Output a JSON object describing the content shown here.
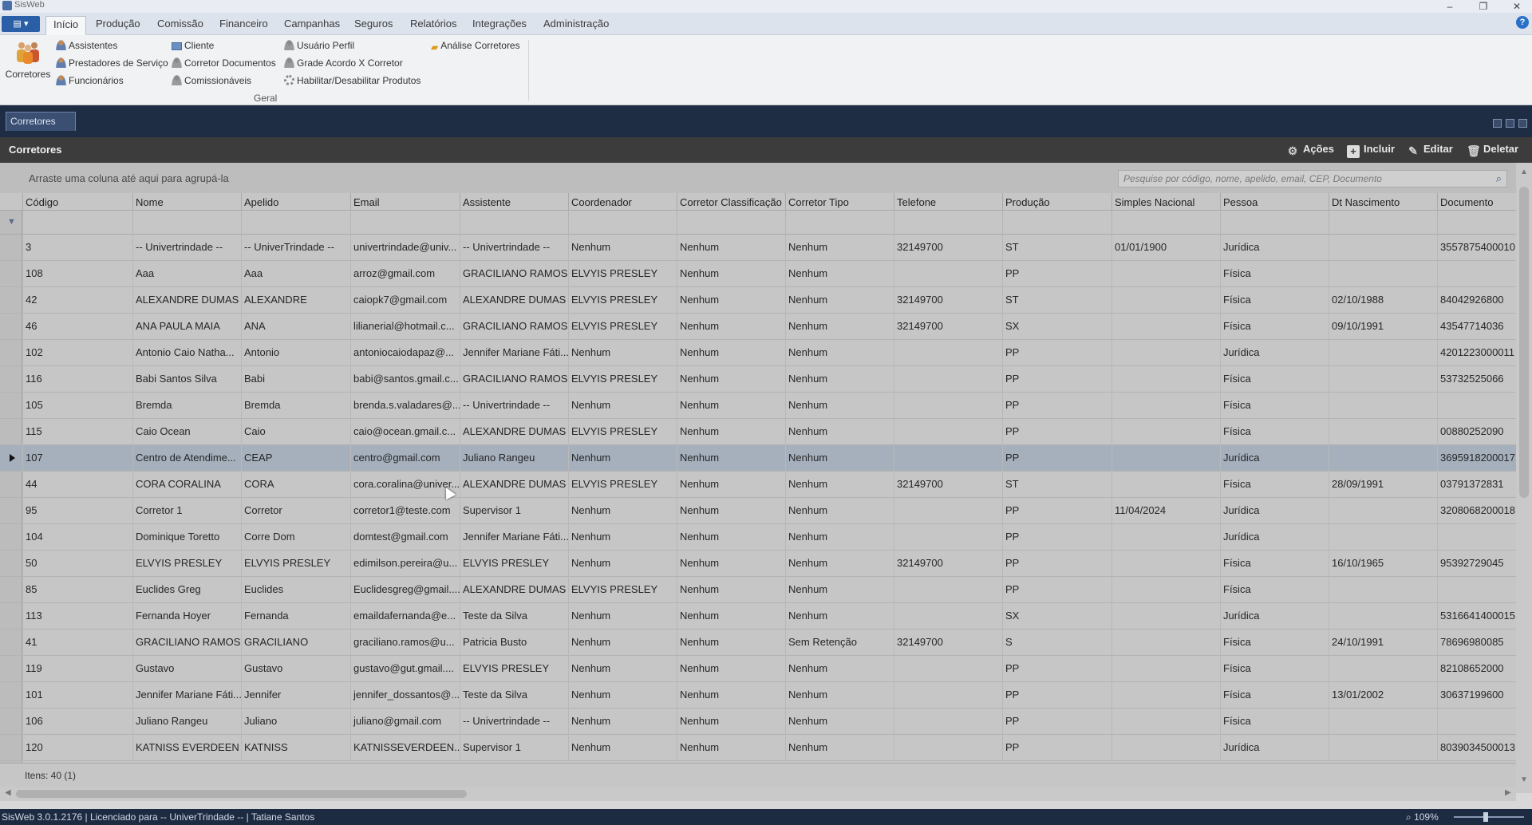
{
  "window": {
    "title": "SisWeb",
    "minimize": "–",
    "restore": "❐",
    "close": "✕"
  },
  "menu": {
    "app_button": "▤ ▾",
    "tabs": [
      "Início",
      "Produção",
      "Comissão",
      "Financeiro",
      "Campanhas",
      "Seguros",
      "Relatórios",
      "Integrações",
      "Administração"
    ],
    "help": "?"
  },
  "ribbon": {
    "big_button": "Corretores",
    "col1": [
      "Assistentes",
      "Prestadores de Serviço",
      "Funcionários"
    ],
    "col2": [
      "Cliente",
      "Corretor Documentos",
      "Comissionáveis"
    ],
    "col3": [
      "Usuário Perfil",
      "Grade Acordo X Corretor",
      "Habilitar/Desabilitar Produtos"
    ],
    "col4": [
      "Análise Corretores"
    ],
    "group_label": "Geral"
  },
  "doc_tab": "Corretores",
  "panel": {
    "title": "Corretores",
    "actions": "Ações",
    "include": "Incluir",
    "edit": "Editar",
    "delete": "Deletar"
  },
  "grid": {
    "group_hint": "Arraste uma coluna até aqui para agrupá-la",
    "search_placeholder": "Pesquise por código, nome, apelido, email, CEP, Documento",
    "columns": [
      "Código",
      "Nome",
      "Apelido",
      "Email",
      "Assistente",
      "Coordenador",
      "Corretor Classificação",
      "Corretor Tipo",
      "Telefone",
      "Produção",
      "Simples Nacional",
      "Pessoa",
      "Dt Nascimento",
      "Documento"
    ],
    "rows": [
      [
        "3",
        "-- Univertrindade --",
        "-- UniverTrindade --",
        "univertrindade@univ...",
        "-- Univertrindade --",
        "Nenhum",
        "Nenhum",
        "Nenhum",
        "32149700",
        "ST",
        "01/01/1900",
        "Jurídica",
        "",
        "3557875400010"
      ],
      [
        "108",
        "Aaa",
        "Aaa",
        "arroz@gmail.com",
        "GRACILIANO RAMOS",
        "ELVYIS PRESLEY",
        "Nenhum",
        "Nenhum",
        "",
        "PP",
        "",
        "Física",
        "",
        ""
      ],
      [
        "42",
        "ALEXANDRE DUMAS",
        "ALEXANDRE",
        "caiopk7@gmail.com",
        "ALEXANDRE DUMAS",
        "ELVYIS PRESLEY",
        "Nenhum",
        "Nenhum",
        "32149700",
        "ST",
        "",
        "Física",
        "02/10/1988",
        "84042926800"
      ],
      [
        "46",
        "ANA PAULA MAIA",
        "ANA",
        "lilianerial@hotmail.c...",
        "GRACILIANO RAMOS",
        "ELVYIS PRESLEY",
        "Nenhum",
        "Nenhum",
        "32149700",
        "SX",
        "",
        "Física",
        "09/10/1991",
        "43547714036"
      ],
      [
        "102",
        "Antonio Caio Natha...",
        "Antonio",
        "antoniocaiodapaz@...",
        "Jennifer Mariane Fáti...",
        "Nenhum",
        "Nenhum",
        "Nenhum",
        "",
        "PP",
        "",
        "Jurídica",
        "",
        "4201223000011"
      ],
      [
        "116",
        "Babi Santos Silva",
        "Babi",
        "babi@santos.gmail.c...",
        "GRACILIANO RAMOS",
        "ELVYIS PRESLEY",
        "Nenhum",
        "Nenhum",
        "",
        "PP",
        "",
        "Física",
        "",
        "53732525066"
      ],
      [
        "105",
        "Bremda",
        "Bremda",
        "brenda.s.valadares@...",
        "-- Univertrindade --",
        "Nenhum",
        "Nenhum",
        "Nenhum",
        "",
        "PP",
        "",
        "Física",
        "",
        ""
      ],
      [
        "115",
        "Caio Ocean",
        "Caio",
        "caio@ocean.gmail.c...",
        "ALEXANDRE DUMAS",
        "ELVYIS PRESLEY",
        "Nenhum",
        "Nenhum",
        "",
        "PP",
        "",
        "Física",
        "",
        "00880252090"
      ],
      [
        "107",
        "Centro de Atendime...",
        "CEAP",
        "centro@gmail.com",
        "Juliano Rangeu",
        "Nenhum",
        "Nenhum",
        "Nenhum",
        "",
        "PP",
        "",
        "Jurídica",
        "",
        "3695918200017"
      ],
      [
        "44",
        "CORA CORALINA",
        "CORA",
        "cora.coralina@univer...",
        "ALEXANDRE DUMAS",
        "ELVYIS PRESLEY",
        "Nenhum",
        "Nenhum",
        "32149700",
        "ST",
        "",
        "Física",
        "28/09/1991",
        "03791372831"
      ],
      [
        "95",
        "Corretor 1",
        "Corretor",
        "corretor1@teste.com",
        "Supervisor 1",
        "Nenhum",
        "Nenhum",
        "Nenhum",
        "",
        "PP",
        "11/04/2024",
        "Jurídica",
        "",
        "3208068200018"
      ],
      [
        "104",
        "Dominique Toretto",
        "Corre Dom",
        "domtest@gmail.com",
        "Jennifer Mariane Fáti...",
        "Nenhum",
        "Nenhum",
        "Nenhum",
        "",
        "PP",
        "",
        "Jurídica",
        "",
        ""
      ],
      [
        "50",
        "ELVYIS PRESLEY",
        "ELVYIS PRESLEY",
        "edimilson.pereira@u...",
        "ELVYIS PRESLEY",
        "Nenhum",
        "Nenhum",
        "Nenhum",
        "32149700",
        "PP",
        "",
        "Física",
        "16/10/1965",
        "95392729045"
      ],
      [
        "85",
        "Euclides Greg",
        "Euclides",
        "Euclidesgreg@gmail....",
        "ALEXANDRE DUMAS",
        "ELVYIS PRESLEY",
        "Nenhum",
        "Nenhum",
        "",
        "PP",
        "",
        "Física",
        "",
        ""
      ],
      [
        "113",
        "Fernanda Hoyer",
        "Fernanda",
        "emaildafernanda@e...",
        "Teste da Silva",
        "Nenhum",
        "Nenhum",
        "Nenhum",
        "",
        "SX",
        "",
        "Jurídica",
        "",
        "5316641400015"
      ],
      [
        "41",
        "GRACILIANO RAMOS",
        "GRACILIANO",
        "graciliano.ramos@u...",
        "Patricia Busto",
        "Nenhum",
        "Nenhum",
        "Sem Retenção",
        "32149700",
        "S",
        "",
        "Física",
        "24/10/1991",
        "78696980085"
      ],
      [
        "119",
        "Gustavo",
        "Gustavo",
        "gustavo@gut.gmail....",
        "ELVYIS PRESLEY",
        "Nenhum",
        "Nenhum",
        "Nenhum",
        "",
        "PP",
        "",
        "Física",
        "",
        "82108652000"
      ],
      [
        "101",
        "Jennifer Mariane Fáti...",
        "Jennifer",
        "jennifer_dossantos@...",
        "Teste da Silva",
        "Nenhum",
        "Nenhum",
        "Nenhum",
        "",
        "PP",
        "",
        "Física",
        "13/01/2002",
        "30637199600"
      ],
      [
        "106",
        "Juliano Rangeu",
        "Juliano",
        "juliano@gmail.com",
        "-- Univertrindade --",
        "Nenhum",
        "Nenhum",
        "Nenhum",
        "",
        "PP",
        "",
        "Física",
        "",
        ""
      ],
      [
        "120",
        "KATNISS EVERDEEN",
        "KATNISS",
        "KATNISSEVERDEEN...",
        "Supervisor 1",
        "Nenhum",
        "Nenhum",
        "Nenhum",
        "",
        "PP",
        "",
        "Jurídica",
        "",
        "8039034500013"
      ]
    ],
    "selected_row": 8,
    "items_count": "Itens: 40 (1)"
  },
  "status": {
    "text": "SisWeb 3.0.1.2176 | Licenciado para -- UniverTrindade -- | Tatiane Santos",
    "zoom": "109%",
    "zoom_level": 1.09
  },
  "colors": {
    "accent": "#2a5ea6",
    "dark_band": "#1f2d44",
    "panel_header": "#3c3c3c",
    "selected_row": "#a6b0bd"
  },
  "icons": {
    "search": "search-icon",
    "filter": "filter-icon",
    "actions": "gear-icon",
    "include": "plus-icon",
    "edit": "edit-icon",
    "delete": "trash-icon"
  }
}
